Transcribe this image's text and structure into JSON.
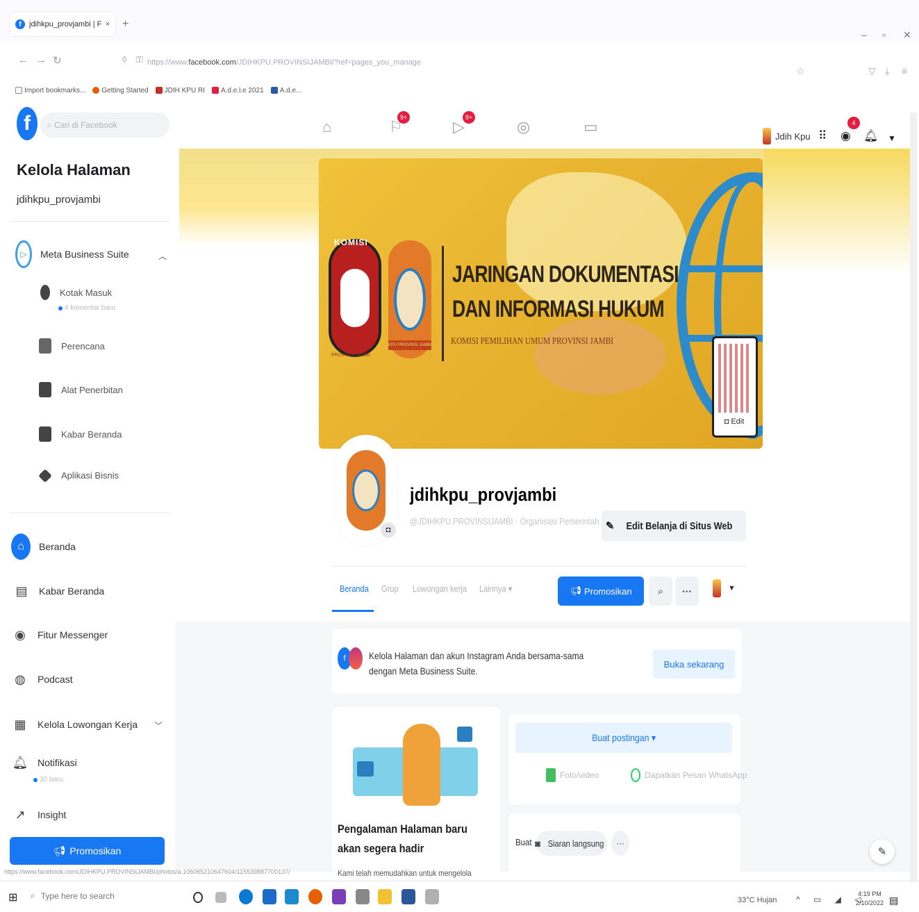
{
  "browser": {
    "tab_title": "jdihkpu_provjambi | Facebook",
    "tab_close": "×",
    "new_tab": "+",
    "url_prefix": "https://www.",
    "url_domain": "facebook.com",
    "url_path": "/JDIHKPU.PROVINSIJAMBI/?ref=pages_you_manage",
    "bookmarks": [
      "Import bookmarks...",
      "Getting Started",
      "JDIH KPU RI",
      "A.d.e.l.e 2021",
      "A.d.e..."
    ],
    "status_url": "https://www.facebook.com/JDIHKPU.PROVINSIJAMBI/photos/a.106065210647604/115539887700137/"
  },
  "header": {
    "search_placeholder": "Cari di Facebook",
    "badge_pages": "9+",
    "badge_watch": "9+",
    "profile_name": "Jdih Kpu",
    "messenger_badge": "4"
  },
  "sidebar": {
    "title": "Kelola Halaman",
    "page_name": "jdihkpu_provjambi",
    "meta_suite": "Meta Business Suite",
    "sub_items": [
      {
        "label": "Kotak Masuk",
        "meta": "4 komentar baru"
      },
      {
        "label": "Perencana"
      },
      {
        "label": "Alat Penerbitan"
      },
      {
        "label": "Kabar Beranda"
      },
      {
        "label": "Aplikasi Bisnis"
      }
    ],
    "items": [
      {
        "label": "Beranda"
      },
      {
        "label": "Kabar Beranda"
      },
      {
        "label": "Fitur Messenger"
      },
      {
        "label": "Podcast"
      },
      {
        "label": "Kelola Lowongan Kerja"
      },
      {
        "label": "Notifikasi",
        "meta": "32 baru"
      },
      {
        "label": "Insight"
      }
    ],
    "promote": "Promosikan"
  },
  "cover": {
    "kpu_top": "KOMISI",
    "kpu_sub": "PROVINSI JAMBI",
    "jdih_tag": "KPU PROVINSI JAMBI",
    "title_line1": "JARINGAN DOKUMENTASI",
    "title_line2": "DAN INFORMASI HUKUM",
    "subtitle": "KOMISI PEMILIHAN UMUM PROVINSI JAMBI",
    "edit": "Edit"
  },
  "page": {
    "name": "jdihkpu_provjambi",
    "handle": "@JDIHKPU.PROVINSIJAMBI · Organisasi Pemerintah",
    "edit_shop": "Edit Belanja di Situs Web",
    "tabs": [
      "Beranda",
      "Grup",
      "Lowongan kerja",
      "Lainnya ▾"
    ],
    "promote": "Promosikan"
  },
  "suite_card": {
    "text": "Kelola Halaman dan akun Instagram Anda bersama-sama dengan Meta Business Suite.",
    "button": "Buka sekarang"
  },
  "experience_card": {
    "title": "Pengalaman Halaman baru akan segera hadir",
    "desc": "Kami telah memudahkan untuk mengelola"
  },
  "post_card": {
    "create_post": "Buat postingan ▾",
    "photo_video": "Foto/video",
    "whatsapp": "Dapatkan Pesan WhatsApp",
    "create_label": "Buat",
    "live": "Siaran langsung",
    "more": "···"
  },
  "taskbar": {
    "search_placeholder": "Type here to search",
    "weather": "33°C  Hujan",
    "time": "4:19 PM",
    "date": "2/10/2022"
  },
  "colors": {
    "fb_blue": "#1877f2",
    "cover_gold": "#e8b330",
    "badge_red": "#e41e3f"
  }
}
